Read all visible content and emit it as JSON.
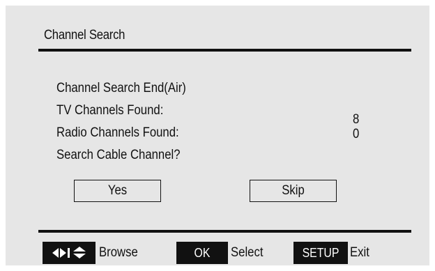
{
  "screen": {
    "title": "Channel Search"
  },
  "info": {
    "line1": "Channel Search End(Air)",
    "tv_label": "TV Channels Found:",
    "tv_count": "8",
    "radio_label": "Radio Channels Found:",
    "radio_count": "0",
    "question": "Search Cable Channel?"
  },
  "buttons": {
    "yes": "Yes",
    "skip": "Skip"
  },
  "footer": {
    "browse_icons": [
      "left-right-arrows-icon",
      "up-down-arrows-icon"
    ],
    "browse_label": "Browse",
    "ok_key": "OK",
    "ok_label": "Select",
    "setup_key": "SETUP",
    "setup_label": "Exit"
  },
  "colors": {
    "background": "#e6e6e6",
    "foreground": "#111111",
    "key_text": "#ffffff"
  }
}
